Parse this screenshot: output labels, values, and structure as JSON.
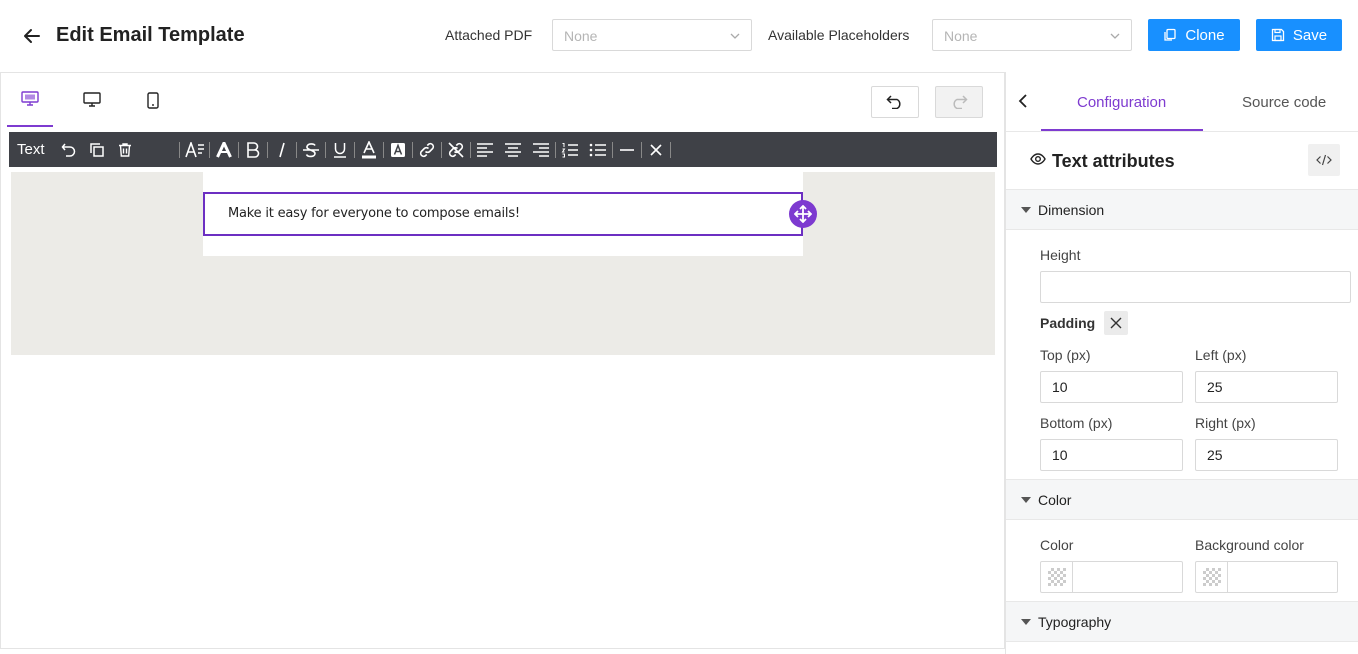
{
  "header": {
    "title": "Edit Email Template",
    "attached_pdf_label": "Attached PDF",
    "attached_pdf_value": "None",
    "placeholders_label": "Available Placeholders",
    "placeholders_value": "None",
    "clone_label": "Clone",
    "save_label": "Save"
  },
  "toolbar": {
    "element_type": "Text"
  },
  "canvas": {
    "text_content": "Make it easy for everyone to compose emails!"
  },
  "panel": {
    "tabs": [
      {
        "label": "Configuration",
        "active": true
      },
      {
        "label": "Source code",
        "active": false
      }
    ],
    "attributes_title": "Text attributes",
    "sections": {
      "dimension": {
        "title": "Dimension",
        "height_label": "Height",
        "height_value": "",
        "padding_label": "Padding",
        "top_label": "Top (px)",
        "top_value": "10",
        "left_label": "Left (px)",
        "left_value": "25",
        "bottom_label": "Bottom (px)",
        "bottom_value": "10",
        "right_label": "Right (px)",
        "right_value": "25"
      },
      "color": {
        "title": "Color",
        "color_label": "Color",
        "color_value": "",
        "background_label": "Background color",
        "background_value": ""
      },
      "typography": {
        "title": "Typography"
      }
    }
  },
  "colors": {
    "primary": "#1890ff",
    "accent": "#7e3bd0",
    "toolbar_bg": "#3f4147",
    "canvas_bg": "#ecebe7"
  }
}
